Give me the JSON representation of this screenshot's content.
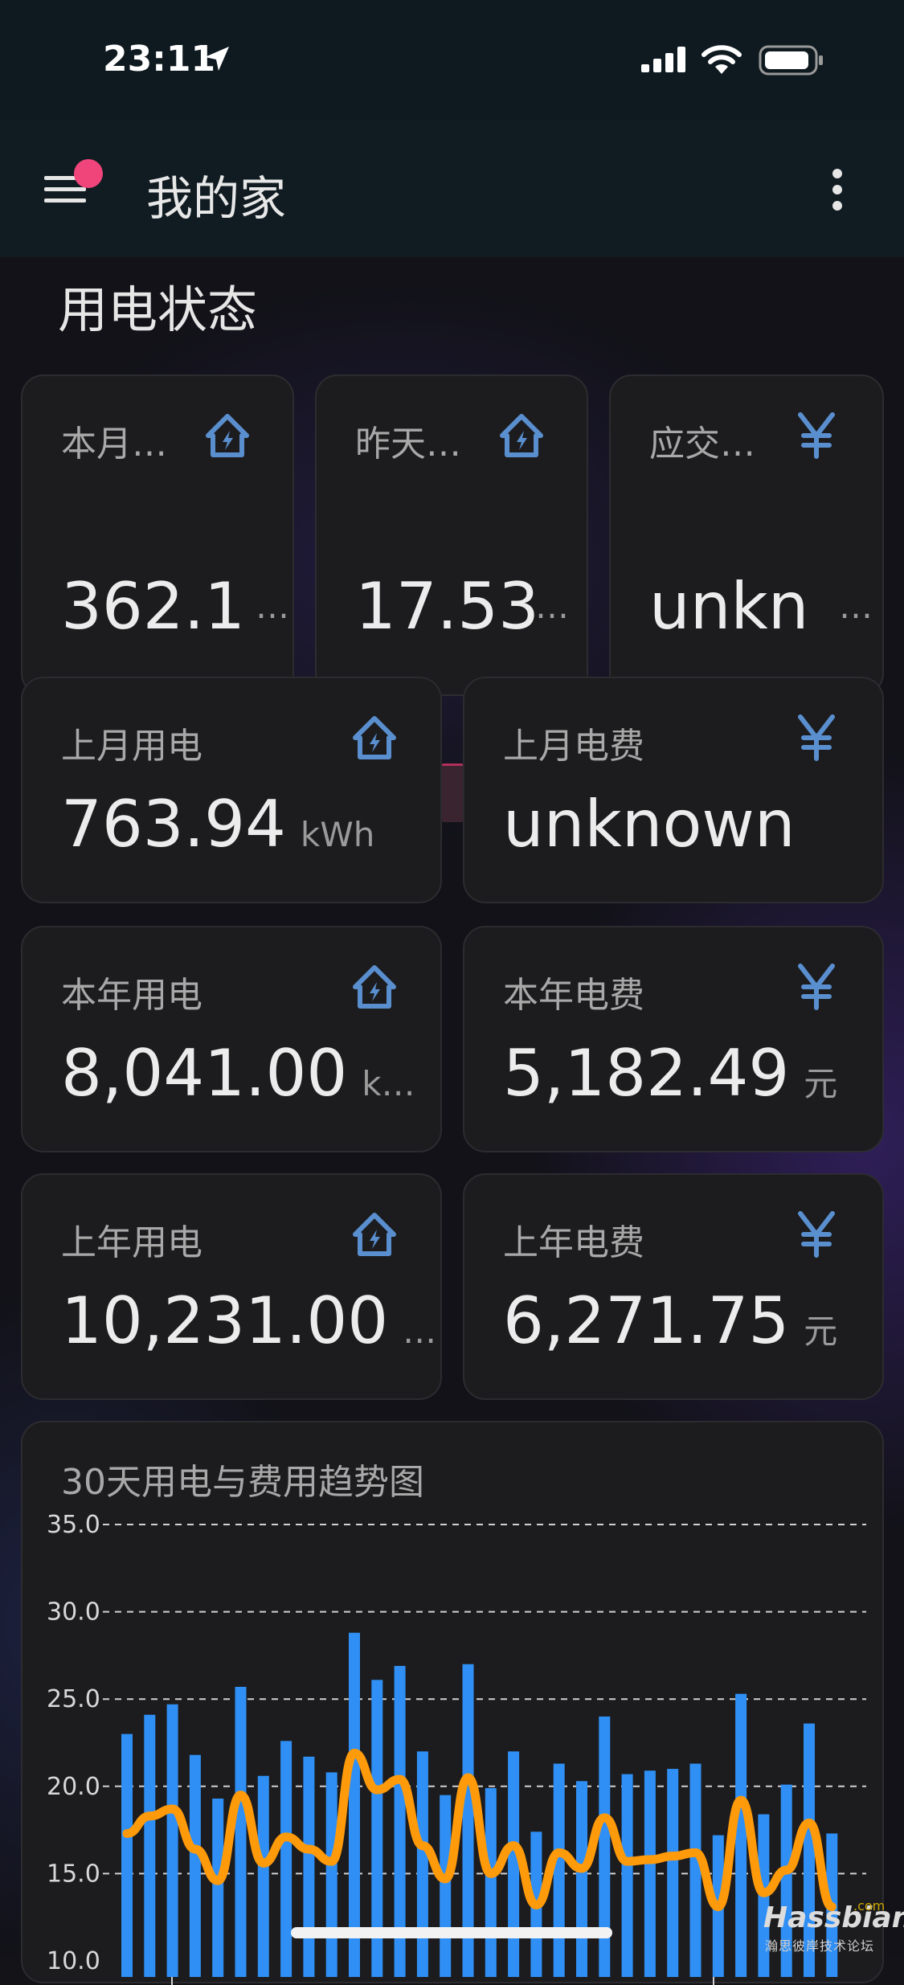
{
  "status_bar": {
    "time": "23:11"
  },
  "app_bar": {
    "title": "我的家"
  },
  "section": {
    "title": "用电状态"
  },
  "top_cards": [
    {
      "label": "本月…",
      "value": "362.1",
      "icon": "home-lightning-icon"
    },
    {
      "label": "昨天…",
      "value": "17.53",
      "icon": "home-lightning-icon"
    },
    {
      "label": "应交…",
      "value": "unkn",
      "icon": "yen-icon"
    }
  ],
  "cards": {
    "last_month_power": {
      "label": "上月用电",
      "value": "763.94",
      "unit": "kWh"
    },
    "last_month_fee": {
      "label": "上月电费",
      "value": "unknown"
    },
    "year_power": {
      "label": "本年用电",
      "value": "8,041.00",
      "unit": "k…"
    },
    "year_fee": {
      "label": "本年电费",
      "value": "5,182.49",
      "unit": "元"
    },
    "last_year_power": {
      "label": "上年用电",
      "value": "10,231.00",
      "unit": "…"
    },
    "last_year_fee": {
      "label": "上年电费",
      "value": "6,271.75",
      "unit": "元"
    }
  },
  "truncation_glyph": "…",
  "watermark": {
    "brand": "Hassbian",
    "suffix": ".com",
    "sub": "瀚思彼岸技术论坛"
  },
  "colors": {
    "bar": "#2f8ff5",
    "line": "#ff9a0a",
    "accent_icon": "#5a8fcf",
    "notification": "#f0457a"
  },
  "chart_data": {
    "type": "bar",
    "title": "30天用电与费用趋势图",
    "ylim": [
      10,
      35
    ],
    "yticks": [
      "35.0",
      "30.0",
      "25.0",
      "20.0",
      "15.0",
      "10.0"
    ],
    "grid": true,
    "series": [
      {
        "values": [
          23.0,
          24.1,
          24.7,
          21.8,
          19.3,
          25.7,
          20.6,
          22.6,
          21.7,
          20.8,
          28.8,
          26.1,
          26.9,
          22.0,
          19.5,
          27.0,
          19.9,
          22.0,
          17.4,
          21.3,
          20.3,
          24.0,
          20.7,
          20.9,
          21.0,
          21.3,
          17.2,
          25.3,
          18.4,
          20.1,
          23.6,
          17.3
        ]
      },
      {
        "values": [
          17.3,
          18.3,
          18.7,
          16.4,
          14.6,
          19.5,
          15.6,
          17.1,
          16.4,
          15.7,
          21.9,
          19.8,
          20.4,
          16.6,
          14.7,
          20.5,
          15.0,
          16.6,
          13.2,
          16.2,
          15.3,
          18.2,
          15.7,
          15.8,
          16.0,
          16.2,
          13.1,
          19.2,
          13.9,
          15.2,
          17.9,
          13.1
        ]
      }
    ]
  }
}
